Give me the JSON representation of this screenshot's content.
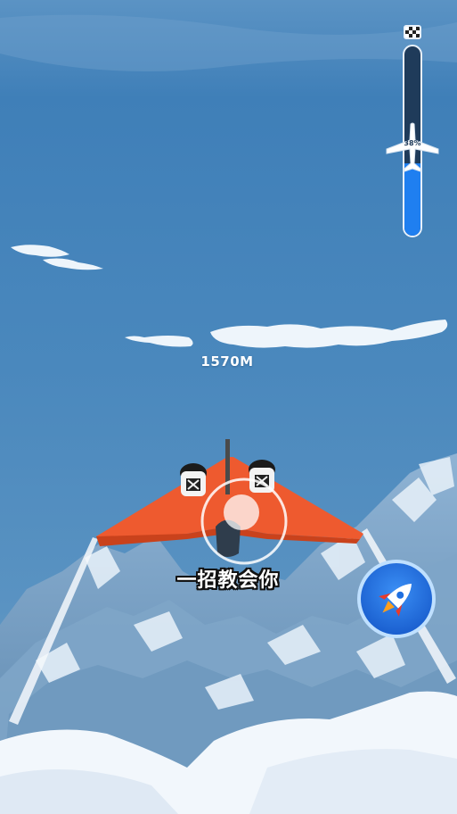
{
  "hud": {
    "distance": "1570M",
    "progress_percent_label": "38%",
    "progress_fraction": 0.38
  },
  "caption": "一招教会你",
  "colors": {
    "sky": "#4b86b8",
    "wing": "#ee5a2f",
    "progress_fill": "#1f7ff0",
    "rocket_button": "#1f6fe0"
  },
  "icons": {
    "finish": "checkered-flag-icon",
    "progress_marker": "airplane-icon",
    "boost": "rocket-icon"
  }
}
